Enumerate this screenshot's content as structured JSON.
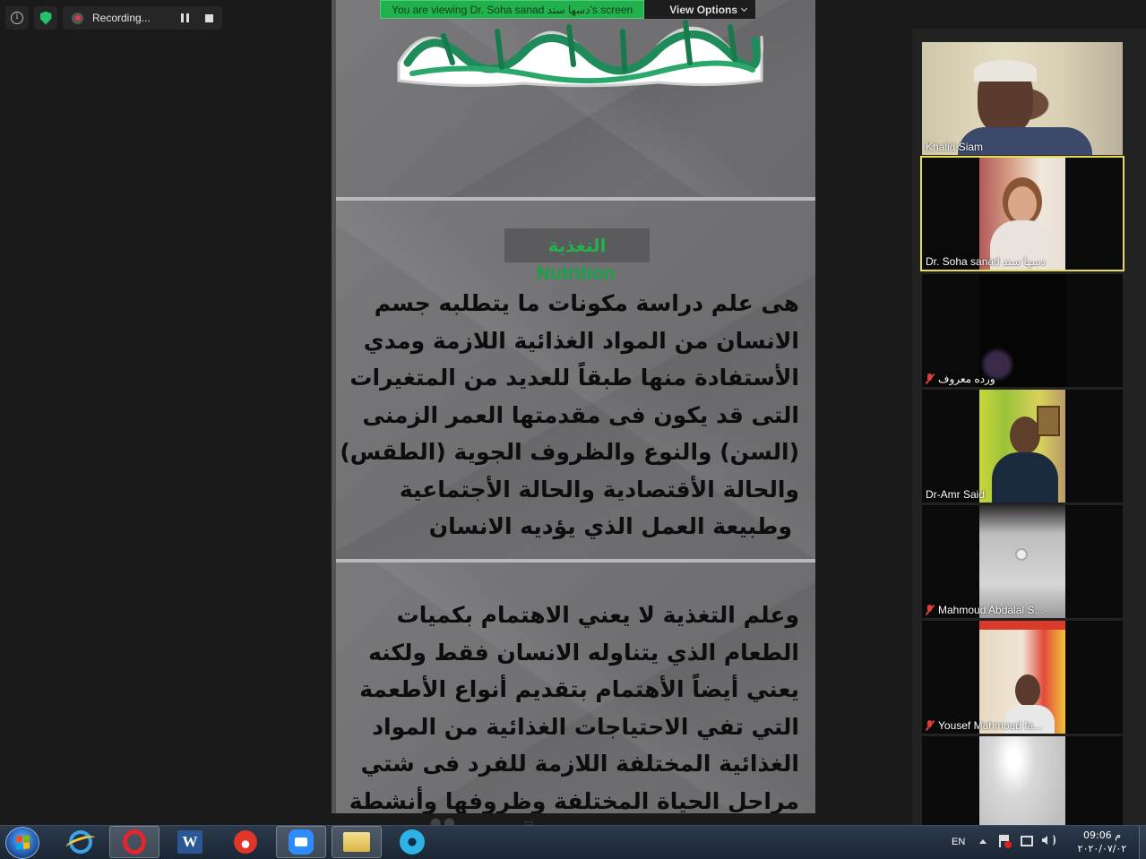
{
  "status": {
    "recording_label": "Recording..."
  },
  "banner": {
    "viewing_text": "You are viewing Dr. Soha sanad دسها سند's screen",
    "view_options_label": "View Options"
  },
  "slide2": {
    "title_ar": "التغذية",
    "title_en": "Nutrition",
    "lines": [
      "هى علم دراسة مكونات ما يتطلبه جسم",
      "الانسان من المواد الغذائية اللازمة ومدي",
      "الأستفادة منها طبقاً للعديد من المتغيرات",
      "التى قد يكون فى مقدمتها العمر الزمنى",
      "(السن) والنوع والظروف الجوية (الطقس)",
      "والحالة الأقتصادية والحالة الأجتماعية",
      "وطبيعة العمل الذي يؤديه الانسان"
    ]
  },
  "slide3": {
    "lines": [
      "وعلم التغذية لا يعني الاهتمام بكميات",
      "الطعام الذي يتناوله الانسان فقط ولكنه",
      "يعني أيضاً الأهتمام بتقديم أنواع الأطعمة",
      "التي تفي الاحتياجات الغذائية من المواد",
      "الغذائية المختلفة اللازمة للفرد فى شتي",
      "مراحل الحياة المختلفة وظروفها وأنشطة"
    ]
  },
  "participants": [
    {
      "name": "Khalid Siam",
      "muted": false,
      "active": false
    },
    {
      "name": "Dr. Soha sanad دسها سند",
      "muted": false,
      "active": true
    },
    {
      "name": "ورده معروف",
      "muted": true,
      "active": false
    },
    {
      "name": "Dr-Amr Said",
      "muted": false,
      "active": false
    },
    {
      "name": "Mahmoud Abdalal S...",
      "muted": true,
      "active": false
    },
    {
      "name": "Yousef Mahmoud fa...",
      "muted": true,
      "active": false
    },
    {
      "name": "",
      "muted": false,
      "active": false
    }
  ],
  "tray": {
    "language": "EN",
    "time": "09:06 م",
    "date": "٢٠٢٠/٠٧/٠٢"
  },
  "colors": {
    "zoom_green": "#23b14d",
    "active_speaker_border": "#e5dc4f",
    "mute_red": "#e23b3b"
  }
}
